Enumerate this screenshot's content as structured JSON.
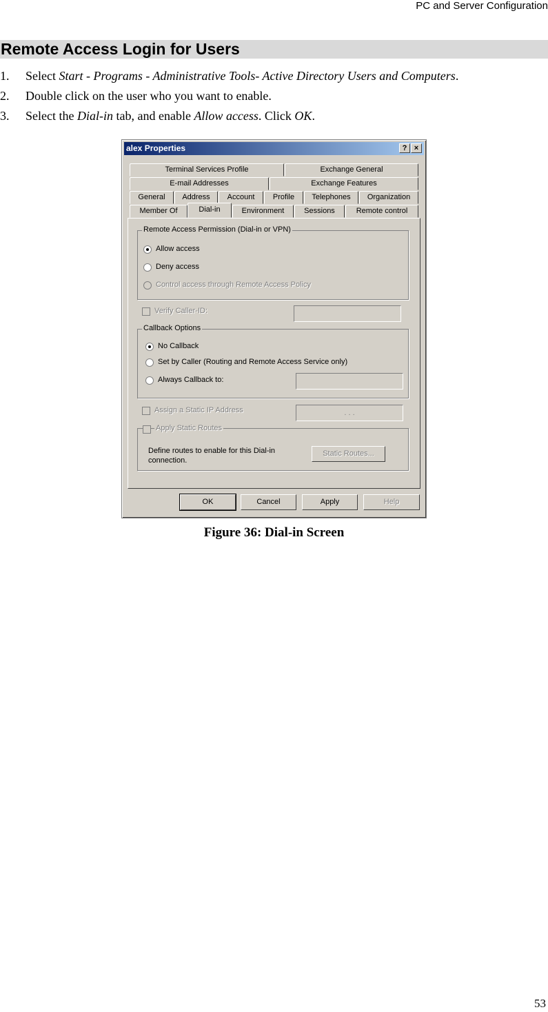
{
  "header": {
    "text": "PC and Server Configuration"
  },
  "section": {
    "title": "Remote Access Login for Users"
  },
  "steps": [
    {
      "num": "1.",
      "pre": "Select ",
      "em": "Start - Programs - Administrative Tools- Active Directory Users and Computers",
      "post": "."
    },
    {
      "num": "2.",
      "text": "Double click on the user who you want to enable."
    },
    {
      "num": "3.",
      "pre": "Select the ",
      "em1": "Dial-in",
      "mid": " tab, and enable ",
      "em2": "Allow access",
      "mid2": ". Click ",
      "em3": "OK",
      "post": "."
    }
  ],
  "dialog": {
    "title": "alex Properties",
    "help_btn": "?",
    "close_btn": "×",
    "tabs_row1": [
      "Terminal Services Profile",
      "Exchange General"
    ],
    "tabs_row2": [
      "E-mail Addresses",
      "Exchange Features"
    ],
    "tabs_row3": [
      "General",
      "Address",
      "Account",
      "Profile",
      "Telephones",
      "Organization"
    ],
    "tabs_row4": [
      "Member Of",
      "Dial-in",
      "Environment",
      "Sessions",
      "Remote control"
    ],
    "remote_group": "Remote Access Permission (Dial-in or VPN)",
    "allow": "Allow access",
    "deny": "Deny access",
    "control": "Control access through Remote Access Policy",
    "verify": "Verify Caller-ID:",
    "callback_group": "Callback Options",
    "no_callback": "No Callback",
    "set_by_caller": "Set by Caller (Routing and Remote Access Service only)",
    "always_callback": "Always Callback to:",
    "static_ip": "Assign a Static IP Address",
    "static_routes": "Apply Static Routes",
    "routes_desc_1": "Define routes to enable for this Dial-in",
    "routes_desc_2": "connection.",
    "static_routes_btn": "Static Routes...",
    "ip_dots": ".          .          .",
    "ok": "OK",
    "cancel": "Cancel",
    "apply": "Apply",
    "help": "Help"
  },
  "caption": "Figure 36: Dial-in Screen",
  "page_number": "53"
}
